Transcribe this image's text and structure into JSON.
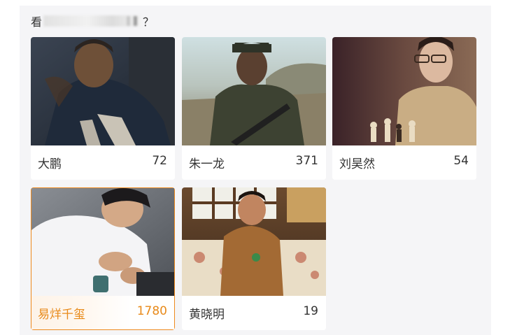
{
  "question": {
    "prefix": "看",
    "suffix": "？"
  },
  "cards": [
    {
      "name": "大鹏",
      "votes": "72",
      "selected": false
    },
    {
      "name": "朱一龙",
      "votes": "371",
      "selected": false
    },
    {
      "name": "刘昊然",
      "votes": "54",
      "selected": false
    },
    {
      "name": "易烊千玺",
      "votes": "1780",
      "selected": true
    },
    {
      "name": "黄晓明",
      "votes": "19",
      "selected": false
    }
  ],
  "colors": {
    "panel_bg": "#f5f5f7",
    "selected_accent": "#ee8a1e",
    "text": "#333333"
  }
}
